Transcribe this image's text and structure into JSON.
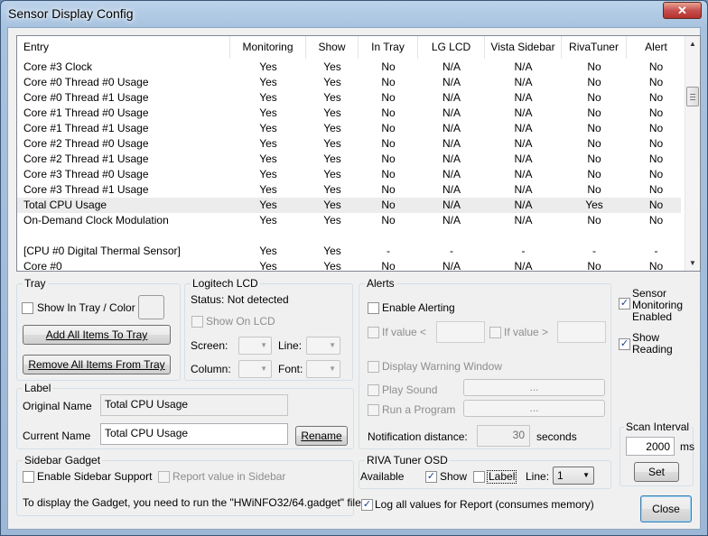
{
  "window": {
    "title": "Sensor Display Config",
    "close_glyph": "✕"
  },
  "table": {
    "columns": [
      "Entry",
      "Monitoring",
      "Show",
      "In Tray",
      "LG LCD",
      "Vista Sidebar",
      "RivaTuner",
      "Alert"
    ],
    "rows": [
      [
        "Core #3 Clock",
        "Yes",
        "Yes",
        "No",
        "N/A",
        "N/A",
        "No",
        "No"
      ],
      [
        "Core #0 Thread #0 Usage",
        "Yes",
        "Yes",
        "No",
        "N/A",
        "N/A",
        "No",
        "No"
      ],
      [
        "Core #0 Thread #1 Usage",
        "Yes",
        "Yes",
        "No",
        "N/A",
        "N/A",
        "No",
        "No"
      ],
      [
        "Core #1 Thread #0 Usage",
        "Yes",
        "Yes",
        "No",
        "N/A",
        "N/A",
        "No",
        "No"
      ],
      [
        "Core #1 Thread #1 Usage",
        "Yes",
        "Yes",
        "No",
        "N/A",
        "N/A",
        "No",
        "No"
      ],
      [
        "Core #2 Thread #0 Usage",
        "Yes",
        "Yes",
        "No",
        "N/A",
        "N/A",
        "No",
        "No"
      ],
      [
        "Core #2 Thread #1 Usage",
        "Yes",
        "Yes",
        "No",
        "N/A",
        "N/A",
        "No",
        "No"
      ],
      [
        "Core #3 Thread #0 Usage",
        "Yes",
        "Yes",
        "No",
        "N/A",
        "N/A",
        "No",
        "No"
      ],
      [
        "Core #3 Thread #1 Usage",
        "Yes",
        "Yes",
        "No",
        "N/A",
        "N/A",
        "No",
        "No"
      ],
      [
        "Total CPU Usage",
        "Yes",
        "Yes",
        "No",
        "N/A",
        "N/A",
        "Yes",
        "No"
      ],
      [
        "On-Demand Clock Modulation",
        "Yes",
        "Yes",
        "No",
        "N/A",
        "N/A",
        "No",
        "No"
      ],
      [
        "",
        "",
        "",
        "",
        "",
        "",
        "",
        ""
      ],
      [
        "[CPU #0 Digital Thermal Sensor]",
        "Yes",
        "Yes",
        "-",
        "-",
        "-",
        "-",
        "-"
      ],
      [
        "Core #0",
        "Yes",
        "Yes",
        "No",
        "N/A",
        "N/A",
        "No",
        "No"
      ]
    ],
    "selected_row": 9
  },
  "tray": {
    "title": "Tray",
    "show_in_tray": "Show In Tray / Color",
    "add_all": "Add All Items To Tray",
    "remove_all": "Remove All Items From Tray"
  },
  "lcd": {
    "title": "Logitech LCD",
    "status": "Status: Not detected",
    "show_on_lcd": "Show On LCD",
    "screen": "Screen:",
    "line": "Line:",
    "column": "Column:",
    "font": "Font:"
  },
  "alerts": {
    "title": "Alerts",
    "enable": "Enable Alerting",
    "if_less": "If value <",
    "if_greater": "If value >",
    "warning_window": "Display Warning Window",
    "play_sound": "Play Sound",
    "run_program": "Run a Program",
    "browse1": "...",
    "browse2": "...",
    "notify_label": "Notification distance:",
    "notify_value": "30",
    "notify_unit": "seconds"
  },
  "side": {
    "sensor_monitoring": [
      "Sensor",
      "Monitoring",
      "Enabled"
    ],
    "show_reading": [
      "Show",
      "Reading"
    ],
    "scan_interval_title": "Scan Interval",
    "scan_value": "2000",
    "scan_unit": "ms",
    "set": "Set"
  },
  "label": {
    "title": "Label",
    "original_name_label": "Original Name",
    "original_name_value": "Total CPU Usage",
    "current_name_label": "Current Name",
    "current_name_value": "Total CPU Usage",
    "rename": "Rename"
  },
  "gadget": {
    "title": "Sidebar Gadget",
    "enable": "Enable Sidebar Support",
    "report": "Report value in Sidebar",
    "info": "To display the Gadget, you need to run the \"HWiNFO32/64.gadget\" file."
  },
  "riva": {
    "title": "RIVA Tuner OSD",
    "available": "Available",
    "show": "Show",
    "label": "Label",
    "line_label": "Line:",
    "line_value": "1"
  },
  "footer": {
    "log_all": "Log all values for Report (consumes memory)",
    "close": "Close"
  }
}
